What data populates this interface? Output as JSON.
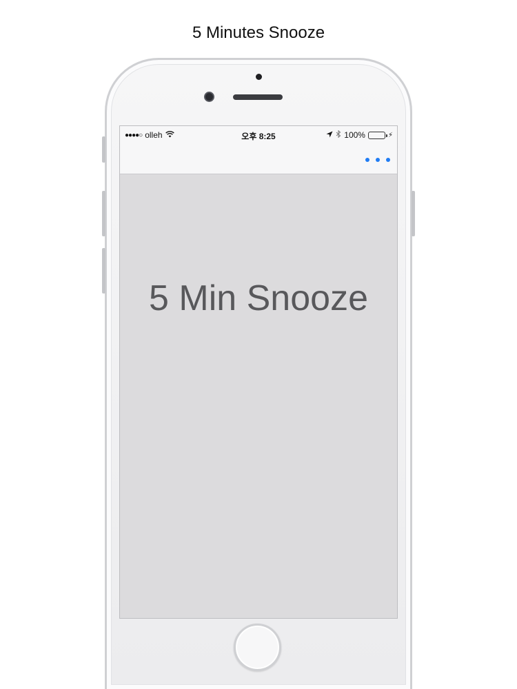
{
  "caption": "5 Minutes Snooze",
  "status_bar": {
    "carrier": "olleh",
    "signal_glyph": "●●●●○",
    "time": "오후 8:25",
    "battery_percent": "100%",
    "icons": [
      "signal-icon",
      "wifi-icon",
      "location-arrow-icon",
      "bluetooth-icon",
      "battery-icon",
      "charging-icon"
    ]
  },
  "nav": {
    "more_icon": "more-dots-icon",
    "accent": "#1f7cf4"
  },
  "main": {
    "label": "5 Min Snooze",
    "background": "#dcdbdd"
  }
}
